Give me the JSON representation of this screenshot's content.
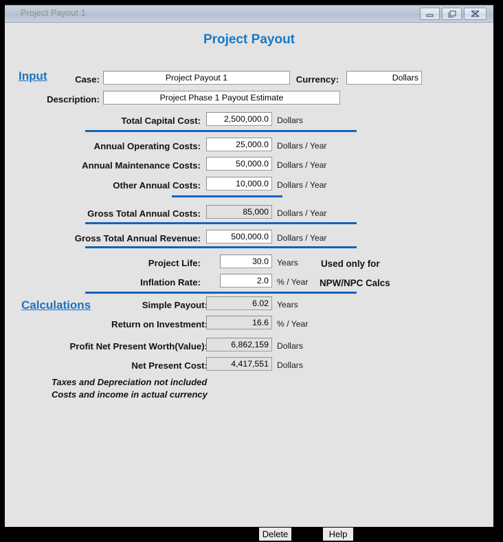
{
  "window": {
    "title": "Project Payout 1",
    "controls": {
      "minimize": "minimize-icon",
      "restore": "restore-icon",
      "close": "close-icon"
    }
  },
  "page_title": "Project Payout",
  "sections": {
    "input_label": "Input",
    "calculations_label": "Calculations"
  },
  "header_fields": {
    "case_label": "Case:",
    "case_value": "Project Payout 1",
    "currency_label": "Currency:",
    "currency_value": "Dollars",
    "description_label": "Description:",
    "description_value": "Project Phase 1 Payout Estimate"
  },
  "input_rows": [
    {
      "label": "Total Capital Cost:",
      "value": "2,500,000.0",
      "unit": "Dollars",
      "readonly": false
    },
    {
      "label": "Annual Operating Costs:",
      "value": "25,000.0",
      "unit": "Dollars / Year",
      "readonly": false
    },
    {
      "label": "Annual Maintenance Costs:",
      "value": "50,000.0",
      "unit": "Dollars / Year",
      "readonly": false
    },
    {
      "label": "Other Annual Costs:",
      "value": "10,000.0",
      "unit": "Dollars / Year",
      "readonly": false
    },
    {
      "label": "Gross Total Annual Costs:",
      "value": "85,000",
      "unit": "Dollars / Year",
      "readonly": true
    },
    {
      "label": "Gross Total Annual Revenue:",
      "value": "500,000.0",
      "unit": "Dollars / Year",
      "readonly": false
    }
  ],
  "life_rows": [
    {
      "label": "Project Life:",
      "value": "30.0",
      "unit": "Years"
    },
    {
      "label": "Inflation Rate:",
      "value": "2.0",
      "unit": "% / Year"
    }
  ],
  "life_note": {
    "line1": "Used only for",
    "line2": "NPW/NPC Calcs"
  },
  "calculation_rows": [
    {
      "label": "Simple Payout:",
      "value": "6.02",
      "unit": "Years"
    },
    {
      "label": "Return on Investment:",
      "value": "16.6",
      "unit": "% / Year"
    },
    {
      "label": "Profit Net Present Worth(Value):",
      "value": "6,862,159",
      "unit": "Dollars"
    },
    {
      "label": "Net Present Cost:",
      "value": "4,417,551",
      "unit": "Dollars"
    }
  ],
  "footnotes": [
    "Taxes and Depreciation not included",
    "Costs and income in actual currency"
  ],
  "buttons": {
    "delete": "Delete",
    "help": "Help"
  },
  "colors": {
    "accent_blue": "#1163c0",
    "title_blue": "#1679c8",
    "window_bg": "#e3e3e3",
    "readonly_field": "#e1e1e1"
  }
}
